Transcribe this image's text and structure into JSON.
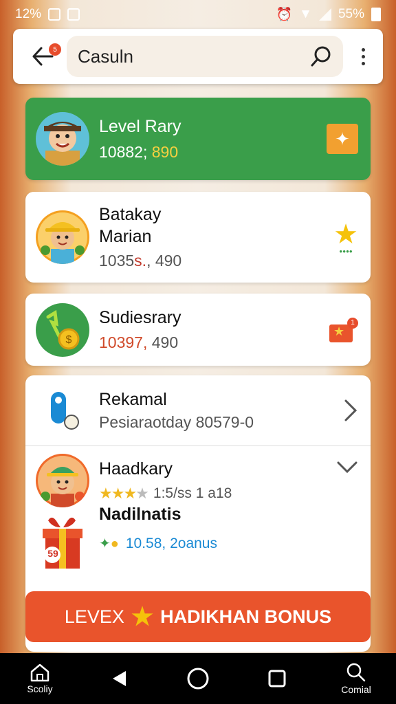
{
  "status_bar": {
    "time": "12%",
    "battery": "55%"
  },
  "search": {
    "value": "Casuln",
    "notification_count": "5"
  },
  "cards": {
    "level": {
      "title": "Level Rary",
      "value_a": "10882;",
      "value_b": "890"
    },
    "batak": {
      "title_line1": "Batakay",
      "title_line2": "Marian",
      "value_a": "1035",
      "value_b": "s.",
      "value_c": "490"
    },
    "sudies": {
      "title": "Sudiesrary",
      "value_a": "10397,",
      "value_b": "490",
      "badge_count": "1"
    },
    "rekamal": {
      "title": "Rekamal",
      "subtitle": "Pesiaraotday 80579-0"
    },
    "haadkary": {
      "title": "Haadkary",
      "rating_text": "1:5/ss 1 a18",
      "stars_filled": 3,
      "stars_total": 4
    },
    "nadilnatis": {
      "title": "Nadilnatis",
      "gift_text": "59",
      "bonus_value": "10.58, 2oanus"
    }
  },
  "bonus_button": {
    "prefix": "LEVEX",
    "label": "HADIKHAN BONUS"
  },
  "nav": {
    "home_label": "Scoliy",
    "search_label": "Comial"
  },
  "colors": {
    "green": "#3a9e4a",
    "orange": "#e9542c",
    "star": "#f0b820",
    "blue_text": "#1a8ad4"
  }
}
